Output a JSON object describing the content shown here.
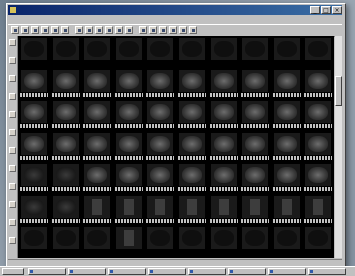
{
  "window": {
    "title": "",
    "controls": [
      "minimize",
      "maximize",
      "close"
    ]
  },
  "viewer": {
    "layout_rows": 7,
    "layout_cols": 10,
    "tile_kinds": [
      [
        "dark",
        "dark",
        "dark",
        "dark",
        "dark",
        "dark",
        "dark",
        "dark",
        "dark",
        "dark"
      ],
      [
        "scan",
        "scan",
        "scan",
        "scan",
        "scan",
        "scan",
        "scan",
        "scan",
        "scan",
        "scan"
      ],
      [
        "scan",
        "scan",
        "scan",
        "scan",
        "scan",
        "scan",
        "scan",
        "scan",
        "scan",
        "scan"
      ],
      [
        "scan",
        "scan",
        "scan",
        "scan",
        "scan",
        "scan",
        "scan",
        "scan",
        "scan",
        "scan"
      ],
      [
        "dim",
        "dim",
        "scan",
        "scan",
        "scan",
        "scan",
        "scan",
        "scan",
        "scan",
        "scan"
      ],
      [
        "dim",
        "dim",
        "stripe",
        "stripe",
        "stripe",
        "stripe",
        "stripe",
        "stripe",
        "stripe",
        "stripe"
      ],
      [
        "dark",
        "dark",
        "dark",
        "stripe",
        "dark",
        "dark",
        "dark",
        "dark",
        "dark",
        "dark"
      ]
    ]
  },
  "toolbar": {
    "buttons": [
      "open-icon",
      "save-icon",
      "print-icon",
      "zoom-icon",
      "undo-icon",
      "layout-icon",
      "grid-icon",
      "series-icon",
      "window-level-icon",
      "measure-icon",
      "pan-icon",
      "rotate-icon",
      "flip-icon",
      "invert-icon",
      "cine-icon",
      "info-icon",
      "export-icon",
      "settings-icon"
    ]
  },
  "left_toolbar": {
    "buttons": [
      "select-icon",
      "zoom-icon",
      "pan-icon",
      "contrast-icon",
      "ruler-icon",
      "angle-icon",
      "roi-icon",
      "text-icon",
      "arrow-icon",
      "reset-icon",
      "prev-icon",
      "next-icon"
    ]
  },
  "taskbar": {
    "start_label": "",
    "items": 8
  }
}
